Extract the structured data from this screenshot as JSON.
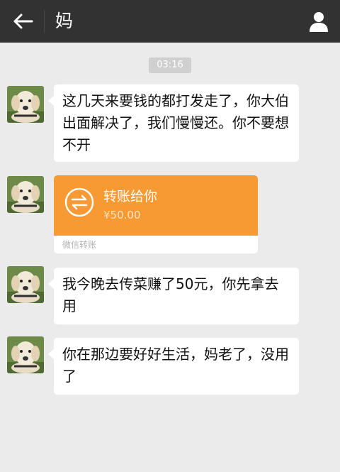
{
  "header": {
    "title": "妈",
    "back_icon": "arrow-left-icon",
    "profile_icon": "person-icon"
  },
  "chat": {
    "timestamp": "03:16",
    "messages": [
      {
        "type": "text",
        "text": "这几天来要钱的都打发走了，你大伯出面解决了，我们慢慢还。你不要想不开"
      },
      {
        "type": "transfer",
        "title": "转账给你",
        "amount": "¥50.00",
        "footer": "微信转账"
      },
      {
        "type": "text",
        "text": "我今晚去传菜赚了50元，你先拿去用"
      },
      {
        "type": "text",
        "text": "你在那边要好好生活，妈老了，没用了"
      }
    ]
  },
  "colors": {
    "topbar": "#323232",
    "background": "#ebebeb",
    "transfer": "#f79a34",
    "timestamp_bg": "#cfcfcf"
  }
}
